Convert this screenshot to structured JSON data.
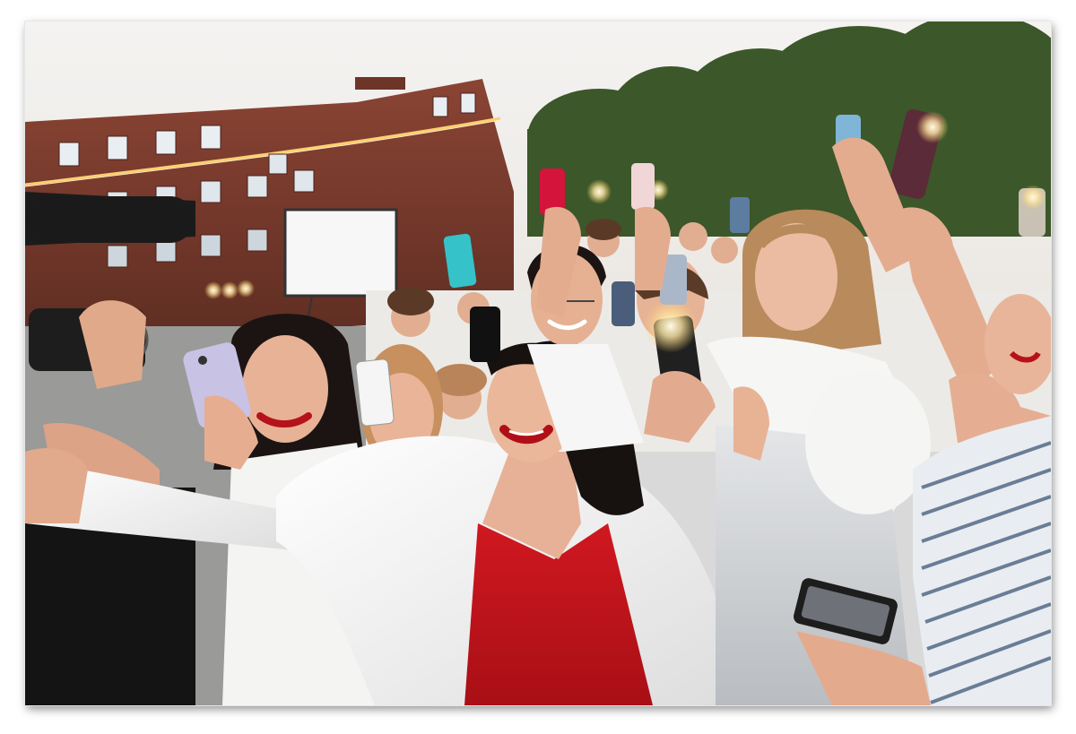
{
  "photo": {
    "description_icon": "crowd-selfie-photo",
    "colors": {
      "sky": "#f2f0ee",
      "brick": "#7a3a2c",
      "trees": "#3f5a2c",
      "jacket": "#f7f7f5",
      "dress": "#c8141b",
      "hair": "#1b1413",
      "skin": "#e9b69a",
      "screen": "#ffffff"
    }
  }
}
